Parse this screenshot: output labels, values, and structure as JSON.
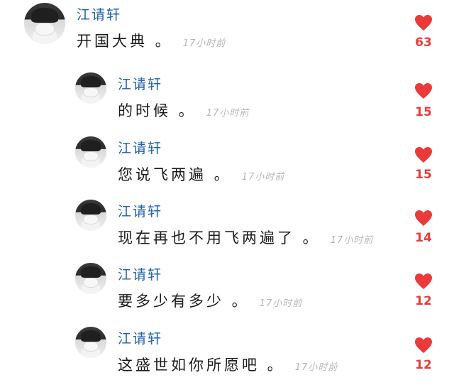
{
  "accent_color": "#ea3a3a",
  "username_color": "#1d5fb0",
  "comments": [
    {
      "user": "江请轩",
      "text": "开国大典 。",
      "time": "17小时前",
      "likes": "63",
      "avatar_icon": "user-avatar-icon",
      "like_icon": "heart-icon"
    },
    {
      "user": "江请轩",
      "text": "的时候 。",
      "time": "17小时前",
      "likes": "15",
      "avatar_icon": "user-avatar-icon",
      "like_icon": "heart-icon"
    },
    {
      "user": "江请轩",
      "text": "您说飞两遍 。",
      "time": "17小时前",
      "likes": "15",
      "avatar_icon": "user-avatar-icon",
      "like_icon": "heart-icon"
    },
    {
      "user": "江请轩",
      "text": "现在再也不用飞两遍了 。",
      "time": "17小时前",
      "likes": "14",
      "avatar_icon": "user-avatar-icon",
      "like_icon": "heart-icon"
    },
    {
      "user": "江请轩",
      "text": "要多少有多少 。",
      "time": "17小时前",
      "likes": "12",
      "avatar_icon": "user-avatar-icon",
      "like_icon": "heart-icon"
    },
    {
      "user": "江请轩",
      "text": "这盛世如你所愿吧 。",
      "time": "17小时前",
      "likes": "12",
      "avatar_icon": "user-avatar-icon",
      "like_icon": "heart-icon"
    }
  ]
}
